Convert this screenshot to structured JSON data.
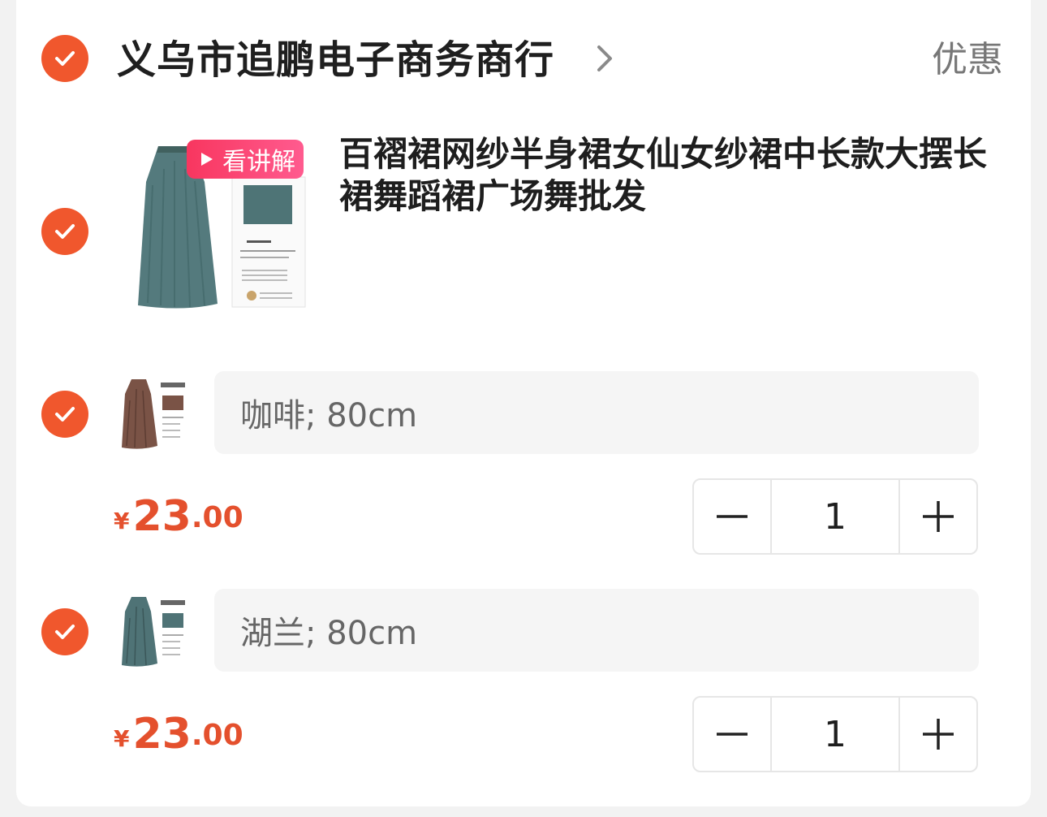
{
  "shop": {
    "name": "义乌市追鹏电子商务商行",
    "promo_label": "优惠"
  },
  "product": {
    "title": "百褶裙网纱半身裙女仙女纱裙中长款大摆长裙舞蹈裙广场舞批发",
    "video_badge": "看讲解"
  },
  "variants": [
    {
      "spec": "咖啡; 80cm",
      "currency": "¥",
      "price_int": "23",
      "price_dec": ".00",
      "quantity": "1",
      "skirt_color": "#7a5346"
    },
    {
      "spec": "湖兰; 80cm",
      "currency": "¥",
      "price_int": "23",
      "price_dec": ".00",
      "quantity": "1",
      "skirt_color": "#4f7376"
    }
  ],
  "colors": {
    "accent": "#f0572d",
    "price": "#e4502d",
    "badge": "#f8365f"
  }
}
